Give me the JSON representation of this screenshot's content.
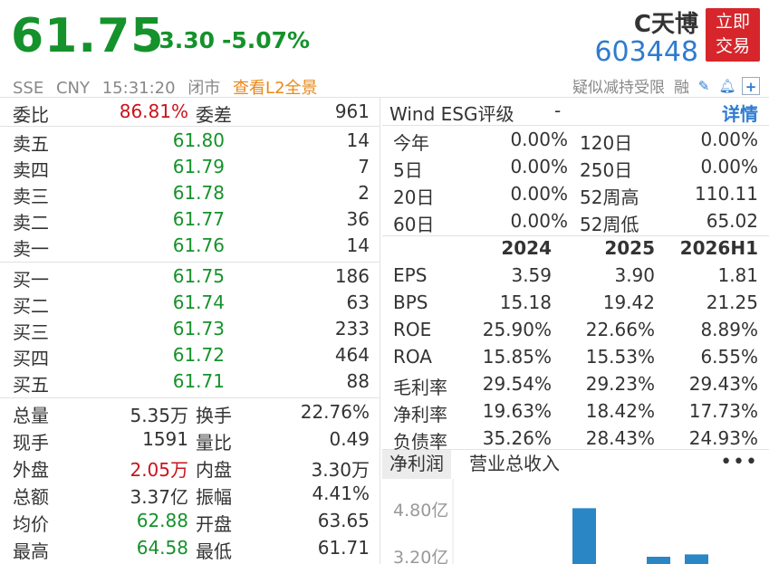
{
  "header": {
    "price": "61.75",
    "change": "-3.30",
    "change_pct": "-5.07%",
    "name": "C天博",
    "code": "603448",
    "trade_button": [
      "立即",
      "交易"
    ],
    "exchange": "SSE",
    "currency": "CNY",
    "time": "15:31:20",
    "status": "闭市",
    "l2_link": "查看L2全景",
    "notice": "疑似减持受限",
    "margin_tag": "融",
    "icons": [
      "edit-icon",
      "bell-icon",
      "add-icon"
    ]
  },
  "order_book": {
    "commission_ratio_label": "委比",
    "commission_ratio": "86.81%",
    "commission_diff_label": "委差",
    "commission_diff": "961",
    "asks": [
      {
        "label": "卖五",
        "price": "61.80",
        "volume": "14"
      },
      {
        "label": "卖四",
        "price": "61.79",
        "volume": "7"
      },
      {
        "label": "卖三",
        "price": "61.78",
        "volume": "2"
      },
      {
        "label": "卖二",
        "price": "61.77",
        "volume": "36"
      },
      {
        "label": "卖一",
        "price": "61.76",
        "volume": "14"
      }
    ],
    "bids": [
      {
        "label": "买一",
        "price": "61.75",
        "volume": "186"
      },
      {
        "label": "买二",
        "price": "61.74",
        "volume": "63"
      },
      {
        "label": "买三",
        "price": "61.73",
        "volume": "233"
      },
      {
        "label": "买四",
        "price": "61.72",
        "volume": "464"
      },
      {
        "label": "买五",
        "price": "61.71",
        "volume": "88"
      }
    ]
  },
  "stats": [
    {
      "l1": "总量",
      "v1": "5.35万",
      "c1": "dark",
      "l2": "换手",
      "v2": "22.76%",
      "c2": "dark"
    },
    {
      "l1": "现手",
      "v1": "1591",
      "c1": "dark",
      "l2": "量比",
      "v2": "0.49",
      "c2": "dark"
    },
    {
      "l1": "外盘",
      "v1": "2.05万",
      "c1": "red",
      "l2": "内盘",
      "v2": "3.30万",
      "c2": "green"
    },
    {
      "l1": "总额",
      "v1": "3.37亿",
      "c1": "dark",
      "l2": "振幅",
      "v2": "4.41%",
      "c2": "dark"
    },
    {
      "l1": "均价",
      "v1": "62.88",
      "c1": "green",
      "l2": "开盘",
      "v2": "63.65",
      "c2": "green"
    },
    {
      "l1": "最高",
      "v1": "64.58",
      "c1": "green",
      "l2": "最低",
      "v2": "61.71",
      "c2": "green"
    }
  ],
  "esg": {
    "label": "Wind ESG评级",
    "value": "-",
    "detail_link": "详情"
  },
  "returns": [
    {
      "p1": "今年",
      "v1": "0.00%",
      "p2": "120日",
      "v2": "0.00%"
    },
    {
      "p1": "5日",
      "v1": "0.00%",
      "p2": "250日",
      "v2": "0.00%"
    },
    {
      "p1": "20日",
      "v1": "0.00%",
      "p2": "52周高",
      "v2": "110.11"
    },
    {
      "p1": "60日",
      "v1": "0.00%",
      "p2": "52周低",
      "v2": "65.02"
    }
  ],
  "financials": {
    "years": [
      "2024",
      "2025",
      "2026H1"
    ],
    "rows": [
      {
        "label": "EPS",
        "values": [
          "3.59",
          "3.90",
          "1.81"
        ]
      },
      {
        "label": "BPS",
        "values": [
          "15.18",
          "19.42",
          "21.25"
        ]
      },
      {
        "label": "ROE",
        "values": [
          "25.90%",
          "22.66%",
          "8.89%"
        ]
      },
      {
        "label": "ROA",
        "values": [
          "15.85%",
          "15.53%",
          "6.55%"
        ]
      },
      {
        "label": "毛利率",
        "values": [
          "29.54%",
          "29.23%",
          "29.43%"
        ]
      },
      {
        "label": "净利率",
        "values": [
          "19.63%",
          "18.42%",
          "17.73%"
        ]
      },
      {
        "label": "负债率",
        "values": [
          "35.26%",
          "28.43%",
          "24.93%"
        ]
      }
    ]
  },
  "tabs": {
    "items": [
      "净利润",
      "营业总收入"
    ],
    "active": 0,
    "more": "•••"
  },
  "chart_data": {
    "type": "bar",
    "y_ticks": [
      "4.80亿",
      "3.20亿"
    ],
    "y_tick_values": [
      4.8,
      3.2
    ],
    "bar_color": "#2b86c5",
    "values": [
      4.85,
      3.2,
      3.28
    ],
    "note": "bars partially clipped at bottom of view"
  }
}
